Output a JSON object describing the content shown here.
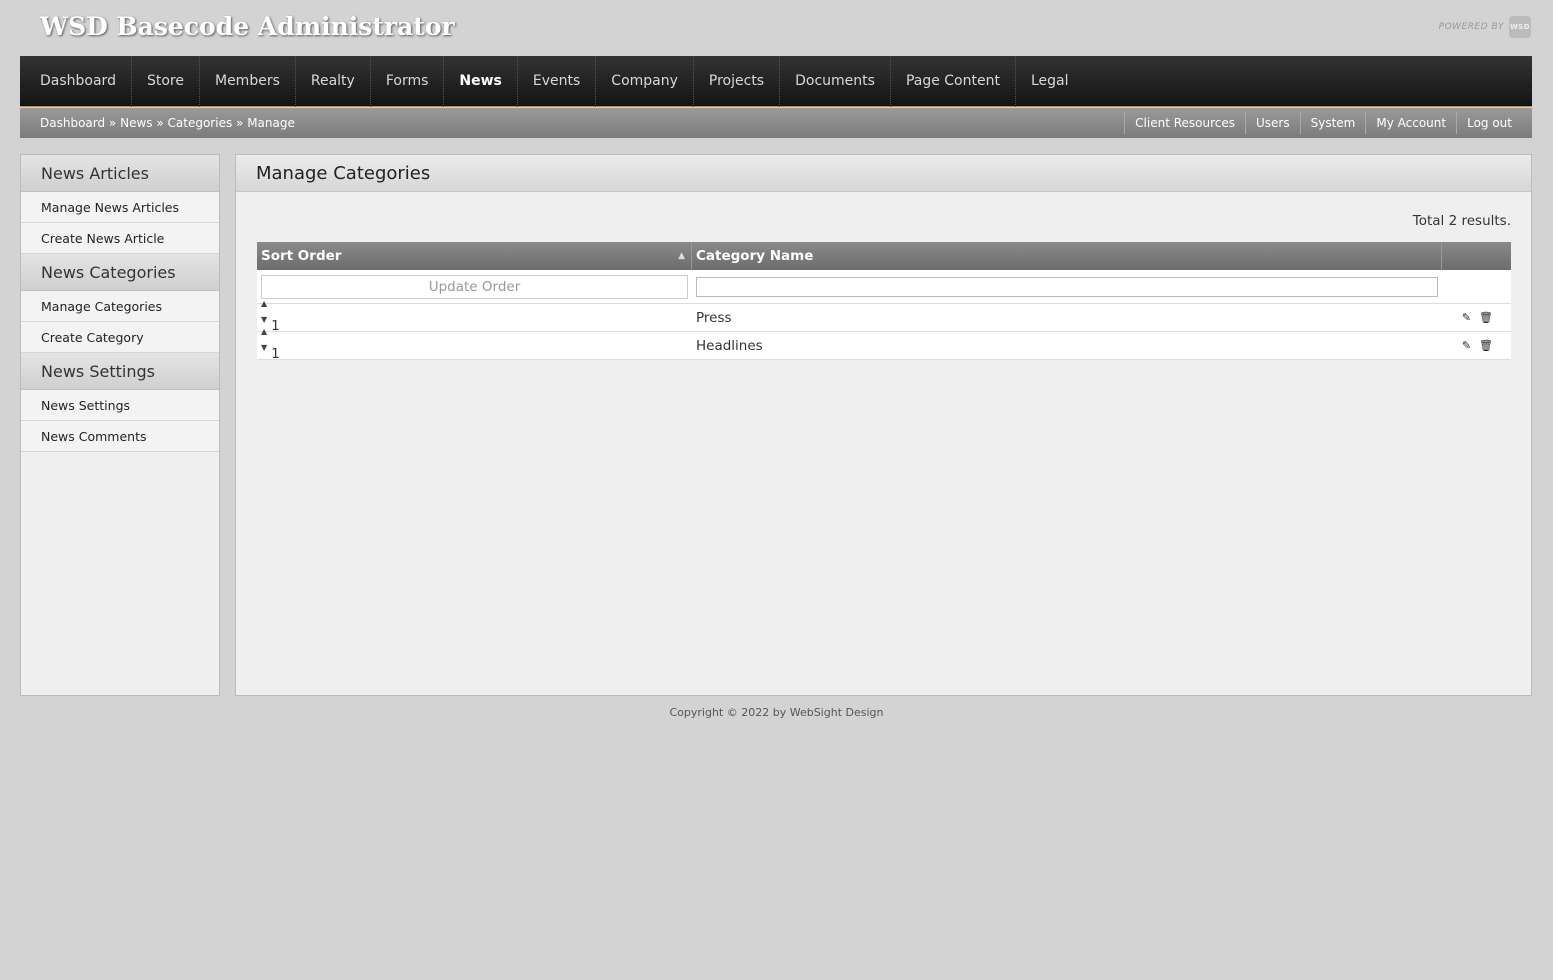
{
  "app": {
    "title": "WSD Basecode Administrator",
    "powered_by": "POWERED BY",
    "logo_text": "WSD"
  },
  "nav": [
    {
      "label": "Dashboard",
      "active": false
    },
    {
      "label": "Store",
      "active": false
    },
    {
      "label": "Members",
      "active": false
    },
    {
      "label": "Realty",
      "active": false
    },
    {
      "label": "Forms",
      "active": false
    },
    {
      "label": "News",
      "active": true
    },
    {
      "label": "Events",
      "active": false
    },
    {
      "label": "Company",
      "active": false
    },
    {
      "label": "Projects",
      "active": false
    },
    {
      "label": "Documents",
      "active": false
    },
    {
      "label": "Page Content",
      "active": false
    },
    {
      "label": "Legal",
      "active": false
    }
  ],
  "breadcrumb": [
    "Dashboard",
    "News",
    "Categories",
    "Manage"
  ],
  "breadcrumb_separator": " » ",
  "util_links": [
    "Client Resources",
    "Users",
    "System",
    "My Account",
    "Log out"
  ],
  "sidebar": [
    {
      "heading": "News Articles",
      "items": [
        "Manage News Articles",
        "Create News Article"
      ]
    },
    {
      "heading": "News Categories",
      "items": [
        "Manage Categories",
        "Create Category"
      ]
    },
    {
      "heading": "News Settings",
      "items": [
        "News Settings",
        "News Comments"
      ]
    }
  ],
  "content": {
    "title": "Manage Categories",
    "total": "Total 2 results.",
    "table": {
      "columns": [
        "Sort Order",
        "Category Name"
      ],
      "update_label": "Update Order",
      "rows": [
        {
          "sort": "1",
          "name": "Press"
        },
        {
          "sort": "1",
          "name": "Headlines"
        }
      ]
    }
  },
  "footer": "Copyright © 2022 by WebSight Design",
  "colors": {
    "nav_accent": "#c9853a",
    "nav_bg": "#1a1a1a",
    "grid_header": "#7a7a7a"
  }
}
